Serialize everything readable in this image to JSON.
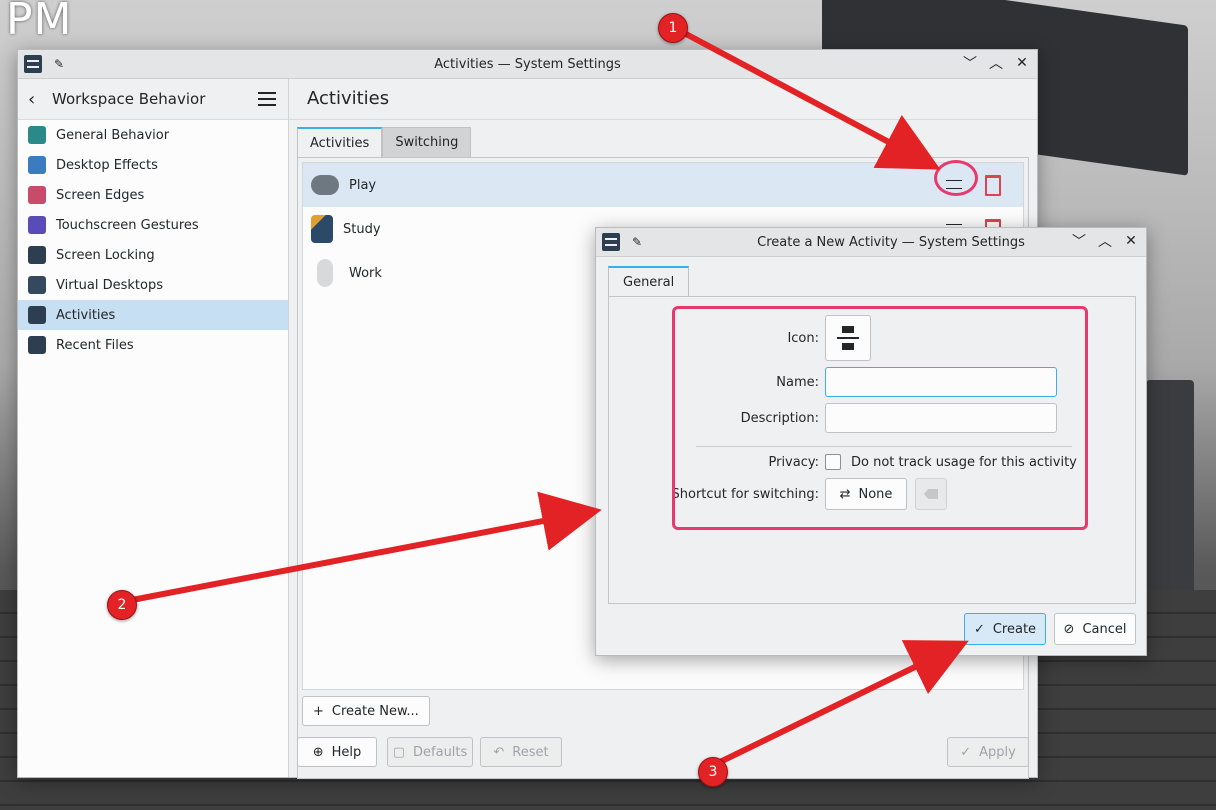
{
  "desktop": {
    "clock_text": "PM"
  },
  "main_window": {
    "title": "Activities — System Settings",
    "sidebar": {
      "header": "Workspace Behavior",
      "items": [
        {
          "label": "General Behavior",
          "icon": "general-behavior-icon",
          "color": "#2a8a8a"
        },
        {
          "label": "Desktop Effects",
          "icon": "desktop-effects-icon",
          "color": "#3b7bbf"
        },
        {
          "label": "Screen Edges",
          "icon": "screen-edges-icon",
          "color": "#c94b6a"
        },
        {
          "label": "Touchscreen Gestures",
          "icon": "touchscreen-gestures-icon",
          "color": "#5a4cb8"
        },
        {
          "label": "Screen Locking",
          "icon": "screen-locking-icon",
          "color": "#2c3e50"
        },
        {
          "label": "Virtual Desktops",
          "icon": "virtual-desktops-icon",
          "color": "#34495e"
        },
        {
          "label": "Activities",
          "icon": "activities-icon",
          "color": "#2c3e50"
        },
        {
          "label": "Recent Files",
          "icon": "recent-files-icon",
          "color": "#2c3e50"
        }
      ],
      "active_index": 6
    },
    "page_title": "Activities",
    "tabs": [
      "Activities",
      "Switching"
    ],
    "activities": [
      {
        "name": "Play",
        "icon": "gamepad-icon"
      },
      {
        "name": "Study",
        "icon": "study-icon"
      },
      {
        "name": "Work",
        "icon": "mouse-icon"
      }
    ],
    "create_new_label": "Create New...",
    "buttons": {
      "help": "Help",
      "defaults": "Defaults",
      "reset": "Reset",
      "apply": "Apply"
    }
  },
  "dialog": {
    "title": "Create a New Activity — System Settings",
    "tab": "General",
    "icon_label": "Icon:",
    "name_label": "Name:",
    "name_value": "",
    "description_label": "Description:",
    "description_value": "",
    "privacy_label": "Privacy:",
    "privacy_option": "Do not track usage for this activity",
    "shortcut_label": "Shortcut for switching:",
    "shortcut_value": "None",
    "create_label": "Create",
    "cancel_label": "Cancel"
  },
  "annotations": {
    "badge1": "1",
    "badge2": "2",
    "badge3": "3",
    "color": "#e32226"
  }
}
